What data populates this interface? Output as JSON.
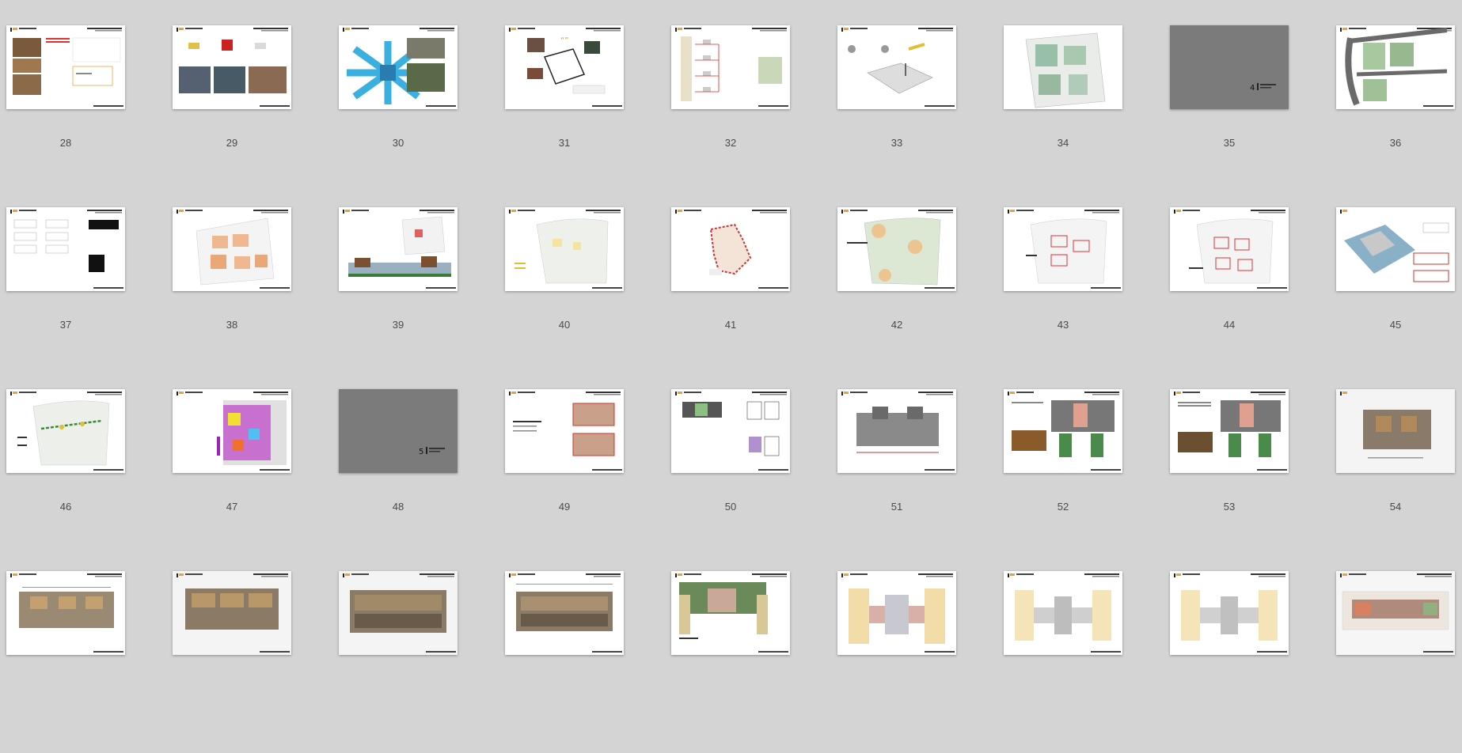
{
  "slides": [
    {
      "number": "28",
      "kind": "photos-text"
    },
    {
      "number": "29",
      "kind": "concept-photos"
    },
    {
      "number": "30",
      "kind": "cross-diagram"
    },
    {
      "number": "31",
      "kind": "collage-cn"
    },
    {
      "number": "32",
      "kind": "flow-text"
    },
    {
      "number": "33",
      "kind": "isometric"
    },
    {
      "number": "34",
      "kind": "green-plan"
    },
    {
      "number": "35",
      "kind": "section-divider"
    },
    {
      "number": "36",
      "kind": "site-plan-road"
    },
    {
      "number": "37",
      "kind": "tables"
    },
    {
      "number": "38",
      "kind": "orange-plan"
    },
    {
      "number": "39",
      "kind": "plan-section"
    },
    {
      "number": "40",
      "kind": "light-plan"
    },
    {
      "number": "41",
      "kind": "red-dots-plan"
    },
    {
      "number": "42",
      "kind": "green-orange-plan"
    },
    {
      "number": "43",
      "kind": "outline-plan"
    },
    {
      "number": "44",
      "kind": "outline-plan-2"
    },
    {
      "number": "45",
      "kind": "perspective-blue"
    },
    {
      "number": "46",
      "kind": "path-plan"
    },
    {
      "number": "47",
      "kind": "heatmap"
    },
    {
      "number": "48",
      "kind": "section-divider-2"
    },
    {
      "number": "49",
      "kind": "unit-plans"
    },
    {
      "number": "50",
      "kind": "unit-grey"
    },
    {
      "number": "51",
      "kind": "floorplan-wide"
    },
    {
      "number": "52",
      "kind": "interior-plan"
    },
    {
      "number": "53",
      "kind": "interior-plan-2"
    },
    {
      "number": "54",
      "kind": "floorplan-single"
    },
    {
      "number": "",
      "kind": "floorplan-row-a"
    },
    {
      "number": "",
      "kind": "floorplan-row-b"
    },
    {
      "number": "",
      "kind": "floorplan-row-c"
    },
    {
      "number": "",
      "kind": "floorplan-row-d"
    },
    {
      "number": "",
      "kind": "landscape-plan"
    },
    {
      "number": "",
      "kind": "color-plan"
    },
    {
      "number": "",
      "kind": "grey-plan"
    },
    {
      "number": "",
      "kind": "grey-plan-2"
    },
    {
      "number": "",
      "kind": "site-strip"
    }
  ],
  "divider_labels": {
    "35": "4",
    "48": "5"
  }
}
